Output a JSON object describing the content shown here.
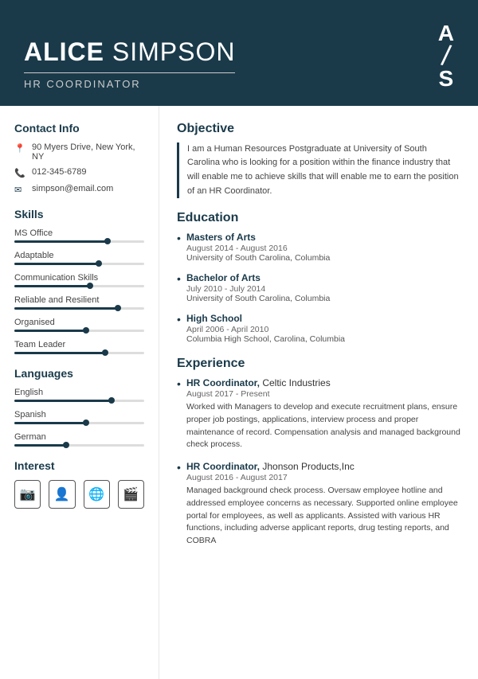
{
  "header": {
    "first_name": "ALICE",
    "last_name": "SIMPSON",
    "title": "HR COORDINATOR",
    "monogram_first": "A",
    "monogram_slash": "/",
    "monogram_last": "S"
  },
  "contact": {
    "section_title": "Contact Info",
    "address": "90 Myers Drive, New York, NY",
    "phone": "012-345-6789",
    "email": "simpson@email.com"
  },
  "skills": {
    "section_title": "Skills",
    "items": [
      {
        "name": "MS Office",
        "percent": 72
      },
      {
        "name": "Adaptable",
        "percent": 65
      },
      {
        "name": "Communication Skills",
        "percent": 58
      },
      {
        "name": "Reliable and Resilient",
        "percent": 80
      },
      {
        "name": "Organised",
        "percent": 55
      },
      {
        "name": "Team Leader",
        "percent": 70
      }
    ]
  },
  "languages": {
    "section_title": "Languages",
    "items": [
      {
        "name": "English",
        "percent": 75
      },
      {
        "name": "Spanish",
        "percent": 55
      },
      {
        "name": "German",
        "percent": 40
      }
    ]
  },
  "interest": {
    "section_title": "Interest",
    "icons": [
      "📷",
      "👤",
      "🌐",
      "🎬"
    ]
  },
  "objective": {
    "section_title": "Objective",
    "text": "I am a Human Resources Postgraduate at University of South Carolina who is looking for a position within the finance industry that will enable me to achieve skills that will enable me to earn the position of an HR Coordinator."
  },
  "education": {
    "section_title": "Education",
    "items": [
      {
        "degree": "Masters of Arts",
        "dates": "August 2014 - August 2016",
        "school": "University of South Carolina, Columbia"
      },
      {
        "degree": "Bachelor of Arts",
        "dates": "July 2010 - July 2014",
        "school": "University of South Carolina, Columbia"
      },
      {
        "degree": "High School",
        "dates": "April 2006 - April 2010",
        "school": "Columbia High School, Carolina, Columbia"
      }
    ]
  },
  "experience": {
    "section_title": "Experience",
    "items": [
      {
        "title": "HR Coordinator",
        "company": "Celtic Industries",
        "dates": "August 2017 - Present",
        "description": "Worked with Managers to develop and execute recruitment plans, ensure proper job postings, applications, interview process and proper maintenance of record. Compensation analysis and managed background check process."
      },
      {
        "title": "HR Coordinator",
        "company": "Jhonson Products,Inc",
        "dates": "August 2016 - August 2017",
        "description": "Managed background check process. Oversaw employee hotline and addressed employee concerns as necessary. Supported online employee portal for employees, as well as applicants. Assisted with various HR functions, including adverse applicant reports, drug testing reports, and COBRA"
      }
    ]
  }
}
